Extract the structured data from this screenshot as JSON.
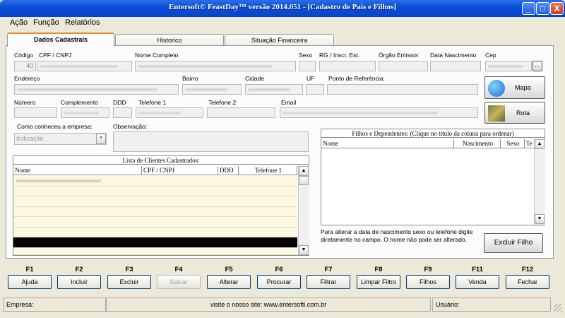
{
  "window": {
    "title": "Entersoft© FeastDay™ versão 2014.051 - [Cadastro de Pais e Filhos]",
    "min": "_",
    "max": "□",
    "close": "X"
  },
  "menu": [
    "Ação",
    "Função",
    "Relatórios"
  ],
  "tabs": [
    "Dados Cadastrais",
    "Historico",
    "Situação Financeira"
  ],
  "labels": {
    "codigo": "Código",
    "cpf": "CPF / CNPJ",
    "nome": "Nome Completo",
    "sexo": "Sexo",
    "rg": "RG / Inscr. Est.",
    "orgao": "Órgão Emissor",
    "nascimento": "Data Nascimento",
    "cep": "Cep",
    "endereco": "Endereço",
    "bairro": "Bairro",
    "cidade": "Cidade",
    "uf": "UF",
    "referencia": "Ponto de Referência:",
    "numero": "Número",
    "complemento": "Complemento",
    "ddd": "DDD",
    "telefone1": "Telefone 1",
    "telefone2": "Telefone 2",
    "email": "Email",
    "como_conheceu": "Como conheceu a empresa:",
    "observacao": "Observação:"
  },
  "values": {
    "codigo": "40",
    "como_conheceu": "Indicação",
    "cep_button": "..."
  },
  "buttons": {
    "mapa": "Mapa",
    "rota": "Rota",
    "excluir_filho": "Excluir Filho"
  },
  "clientes": {
    "title": "Lista de Clientes Cadastrados:",
    "columns": [
      "Nome",
      "CPF / CNPJ",
      "DDD",
      "Telefone 1"
    ]
  },
  "filhos": {
    "title": "Filhos e Dependentes: (Clique no título da coluna para ordenar)",
    "columns": [
      "Nome",
      "Nascimento",
      "Sexo",
      "Te"
    ],
    "hint": "Para alterar a data de nascimento sexo ou telefone digite diretamente no campo.  O nome não pode ser alterado."
  },
  "fkeys": [
    {
      "key": "F1",
      "label": "Ajuda",
      "enabled": true
    },
    {
      "key": "F2",
      "label": "Incluir",
      "enabled": true
    },
    {
      "key": "F3",
      "label": "Excluir",
      "enabled": true
    },
    {
      "key": "F4",
      "label": "Salvar",
      "enabled": false
    },
    {
      "key": "F5",
      "label": "Alterar",
      "enabled": true
    },
    {
      "key": "F6",
      "label": "Procurar",
      "enabled": true
    },
    {
      "key": "F7",
      "label": "Filtrar",
      "enabled": true
    },
    {
      "key": "F8",
      "label": "Limpar Filtro",
      "enabled": true
    },
    {
      "key": "F9",
      "label": "Filhos",
      "enabled": true
    },
    {
      "key": "F11",
      "label": "Venda",
      "enabled": true
    },
    {
      "key": "F12",
      "label": "Fechar",
      "enabled": true
    }
  ],
  "statusbar": {
    "empresa": "Empresa:",
    "site": "visite o nosso site: www.entersofti.com.br",
    "usuario": "Usuário:"
  },
  "colors": {
    "titlebar": "#0a4fd6",
    "tab_accent": "#e68b2c",
    "list_row": "#fcf8e0",
    "selected_row": "#000000"
  }
}
